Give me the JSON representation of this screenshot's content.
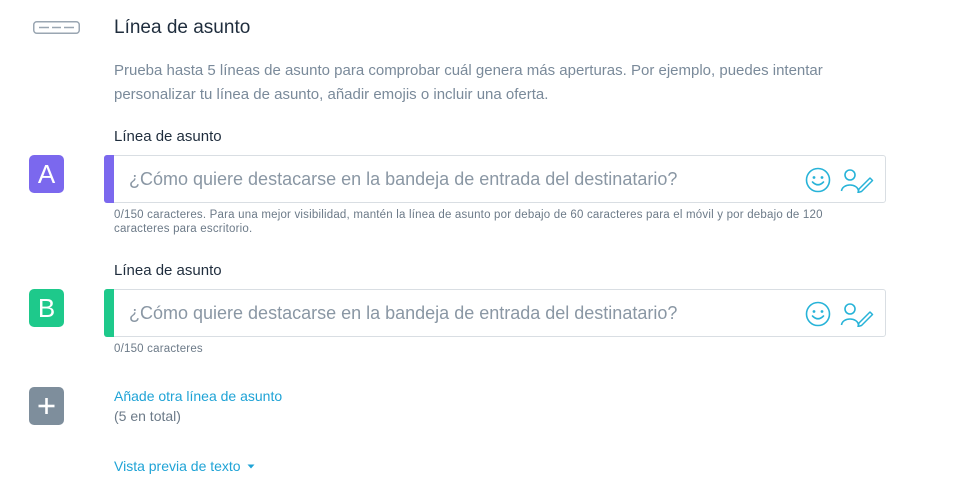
{
  "section": {
    "icon": "subject-line-icon",
    "title": "Línea de asunto",
    "description": "Prueba hasta 5 líneas de asunto para comprobar cuál genera más aperturas. Por ejemplo, puedes intentar personalizar tu línea de asunto, añadir emojis o incluir una oferta."
  },
  "variants": [
    {
      "label": "Línea de asunto",
      "badge": "A",
      "color": "#7b68ee",
      "placeholder": "¿Cómo quiere destacarse en la bandeja de entrada del destinatario?",
      "value": "",
      "help": "0/150 caracteres. Para una mejor visibilidad, mantén la línea de asunto por debajo de 60 caracteres para el móvil y por debajo de 120 caracteres para escritorio."
    },
    {
      "label": "Línea de asunto",
      "badge": "B",
      "color": "#1ec98b",
      "placeholder": "¿Cómo quiere destacarse en la bandeja de entrada del destinatario?",
      "value": "",
      "help": "0/150 caracteres"
    }
  ],
  "icons": {
    "emoji": "smiley-icon",
    "personalize": "person-pen-icon",
    "add": "plus-icon",
    "caret": "caret-down-icon"
  },
  "add_subject": {
    "link": "Añade otra línea de asunto",
    "count": "(5 en total)"
  },
  "preview": {
    "link": "Vista previa de texto"
  },
  "colors": {
    "link": "#1fa3d6",
    "icon_accent": "#27b3d8",
    "add_badge": "#7e8e9c"
  }
}
